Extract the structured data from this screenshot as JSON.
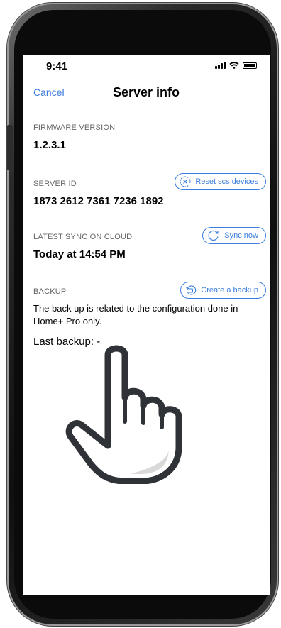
{
  "status_bar": {
    "time": "9:41",
    "icons": [
      "cellular-signal-icon",
      "wifi-icon",
      "battery-icon"
    ]
  },
  "nav": {
    "cancel_label": "Cancel",
    "title": "Server info"
  },
  "firmware": {
    "label": "FIRMWARE VERSION",
    "value": "1.2.3.1"
  },
  "server": {
    "label": "SERVER ID",
    "value": "1873 2612 7361 7236 1892",
    "button_label": "Reset scs devices",
    "button_icon": "x-circle-icon"
  },
  "sync": {
    "label": "LATEST SYNC ON CLOUD",
    "value": "Today at 14:54 PM",
    "button_label": "Sync now",
    "button_icon": "refresh-icon"
  },
  "backup": {
    "label": "BACKUP",
    "button_label": "Create a backup",
    "button_icon": "backup-icon",
    "description": "The back up is related to the configuration done in Home+ Pro only.",
    "last_backup": "Last backup:  -"
  },
  "colors": {
    "accent": "#3b7ddd",
    "label_gray": "#666666",
    "text": "#000000",
    "background": "#ffffff"
  }
}
